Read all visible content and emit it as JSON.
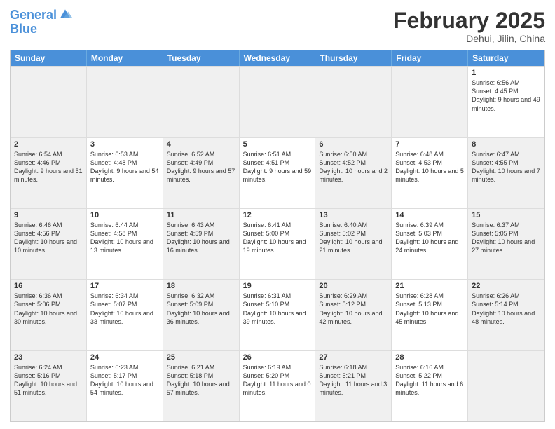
{
  "header": {
    "logo_line1": "General",
    "logo_line2": "Blue",
    "month_title": "February 2025",
    "location": "Dehui, Jilin, China"
  },
  "weekdays": [
    "Sunday",
    "Monday",
    "Tuesday",
    "Wednesday",
    "Thursday",
    "Friday",
    "Saturday"
  ],
  "rows": [
    [
      {
        "day": "",
        "info": "",
        "shaded": true
      },
      {
        "day": "",
        "info": "",
        "shaded": true
      },
      {
        "day": "",
        "info": "",
        "shaded": true
      },
      {
        "day": "",
        "info": "",
        "shaded": true
      },
      {
        "day": "",
        "info": "",
        "shaded": true
      },
      {
        "day": "",
        "info": "",
        "shaded": true
      },
      {
        "day": "1",
        "info": "Sunrise: 6:56 AM\nSunset: 4:45 PM\nDaylight: 9 hours and 49 minutes.",
        "shaded": false
      }
    ],
    [
      {
        "day": "2",
        "info": "Sunrise: 6:54 AM\nSunset: 4:46 PM\nDaylight: 9 hours and 51 minutes.",
        "shaded": true
      },
      {
        "day": "3",
        "info": "Sunrise: 6:53 AM\nSunset: 4:48 PM\nDaylight: 9 hours and 54 minutes.",
        "shaded": false
      },
      {
        "day": "4",
        "info": "Sunrise: 6:52 AM\nSunset: 4:49 PM\nDaylight: 9 hours and 57 minutes.",
        "shaded": true
      },
      {
        "day": "5",
        "info": "Sunrise: 6:51 AM\nSunset: 4:51 PM\nDaylight: 9 hours and 59 minutes.",
        "shaded": false
      },
      {
        "day": "6",
        "info": "Sunrise: 6:50 AM\nSunset: 4:52 PM\nDaylight: 10 hours and 2 minutes.",
        "shaded": true
      },
      {
        "day": "7",
        "info": "Sunrise: 6:48 AM\nSunset: 4:53 PM\nDaylight: 10 hours and 5 minutes.",
        "shaded": false
      },
      {
        "day": "8",
        "info": "Sunrise: 6:47 AM\nSunset: 4:55 PM\nDaylight: 10 hours and 7 minutes.",
        "shaded": true
      }
    ],
    [
      {
        "day": "9",
        "info": "Sunrise: 6:46 AM\nSunset: 4:56 PM\nDaylight: 10 hours and 10 minutes.",
        "shaded": true
      },
      {
        "day": "10",
        "info": "Sunrise: 6:44 AM\nSunset: 4:58 PM\nDaylight: 10 hours and 13 minutes.",
        "shaded": false
      },
      {
        "day": "11",
        "info": "Sunrise: 6:43 AM\nSunset: 4:59 PM\nDaylight: 10 hours and 16 minutes.",
        "shaded": true
      },
      {
        "day": "12",
        "info": "Sunrise: 6:41 AM\nSunset: 5:00 PM\nDaylight: 10 hours and 19 minutes.",
        "shaded": false
      },
      {
        "day": "13",
        "info": "Sunrise: 6:40 AM\nSunset: 5:02 PM\nDaylight: 10 hours and 21 minutes.",
        "shaded": true
      },
      {
        "day": "14",
        "info": "Sunrise: 6:39 AM\nSunset: 5:03 PM\nDaylight: 10 hours and 24 minutes.",
        "shaded": false
      },
      {
        "day": "15",
        "info": "Sunrise: 6:37 AM\nSunset: 5:05 PM\nDaylight: 10 hours and 27 minutes.",
        "shaded": true
      }
    ],
    [
      {
        "day": "16",
        "info": "Sunrise: 6:36 AM\nSunset: 5:06 PM\nDaylight: 10 hours and 30 minutes.",
        "shaded": true
      },
      {
        "day": "17",
        "info": "Sunrise: 6:34 AM\nSunset: 5:07 PM\nDaylight: 10 hours and 33 minutes.",
        "shaded": false
      },
      {
        "day": "18",
        "info": "Sunrise: 6:32 AM\nSunset: 5:09 PM\nDaylight: 10 hours and 36 minutes.",
        "shaded": true
      },
      {
        "day": "19",
        "info": "Sunrise: 6:31 AM\nSunset: 5:10 PM\nDaylight: 10 hours and 39 minutes.",
        "shaded": false
      },
      {
        "day": "20",
        "info": "Sunrise: 6:29 AM\nSunset: 5:12 PM\nDaylight: 10 hours and 42 minutes.",
        "shaded": true
      },
      {
        "day": "21",
        "info": "Sunrise: 6:28 AM\nSunset: 5:13 PM\nDaylight: 10 hours and 45 minutes.",
        "shaded": false
      },
      {
        "day": "22",
        "info": "Sunrise: 6:26 AM\nSunset: 5:14 PM\nDaylight: 10 hours and 48 minutes.",
        "shaded": true
      }
    ],
    [
      {
        "day": "23",
        "info": "Sunrise: 6:24 AM\nSunset: 5:16 PM\nDaylight: 10 hours and 51 minutes.",
        "shaded": true
      },
      {
        "day": "24",
        "info": "Sunrise: 6:23 AM\nSunset: 5:17 PM\nDaylight: 10 hours and 54 minutes.",
        "shaded": false
      },
      {
        "day": "25",
        "info": "Sunrise: 6:21 AM\nSunset: 5:18 PM\nDaylight: 10 hours and 57 minutes.",
        "shaded": true
      },
      {
        "day": "26",
        "info": "Sunrise: 6:19 AM\nSunset: 5:20 PM\nDaylight: 11 hours and 0 minutes.",
        "shaded": false
      },
      {
        "day": "27",
        "info": "Sunrise: 6:18 AM\nSunset: 5:21 PM\nDaylight: 11 hours and 3 minutes.",
        "shaded": true
      },
      {
        "day": "28",
        "info": "Sunrise: 6:16 AM\nSunset: 5:22 PM\nDaylight: 11 hours and 6 minutes.",
        "shaded": false
      },
      {
        "day": "",
        "info": "",
        "shaded": true
      }
    ]
  ]
}
